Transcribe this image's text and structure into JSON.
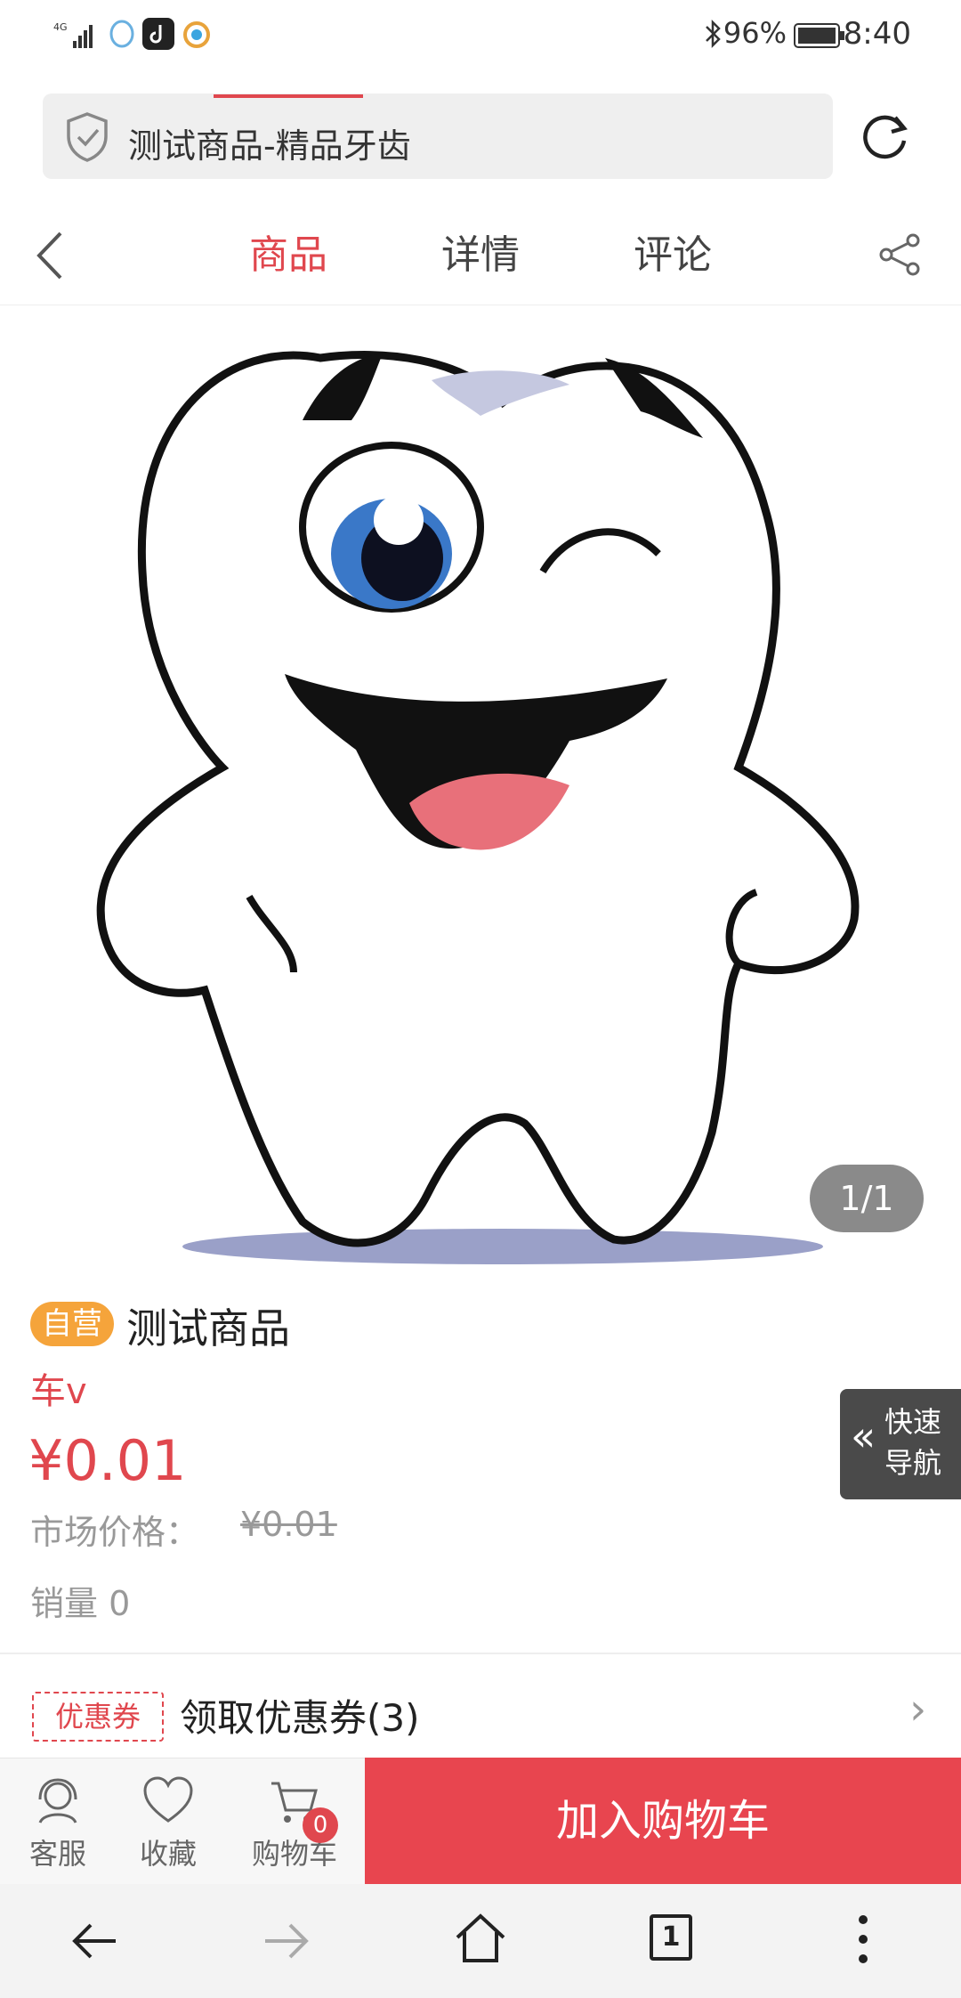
{
  "status_bar": {
    "network": "4G",
    "battery": "96%",
    "time": "8:40"
  },
  "url_bar": {
    "title": "测试商品-精品牙齿"
  },
  "nav_tabs": [
    {
      "label": "商品",
      "active": true
    },
    {
      "label": "详情",
      "active": false
    },
    {
      "label": "评论",
      "active": false
    }
  ],
  "image_counter": "1/1",
  "product": {
    "badge": "自营",
    "name": "测试商品",
    "subtitle": "车v",
    "price": "¥0.01",
    "market_label": "市场价格：",
    "market_price": "¥0.01",
    "sales": "销量 0"
  },
  "quick_nav": {
    "line1": "快速",
    "line2": "导航"
  },
  "coupon": {
    "tag": "优惠券",
    "text": "领取优惠券(3)"
  },
  "action_bar": {
    "service": "客服",
    "favorite": "收藏",
    "cart": "购物车",
    "cart_count": "0",
    "add_to_cart": "加入购物车"
  },
  "system_nav": {
    "tab_count": "1"
  },
  "colors": {
    "accent": "#e0474e",
    "badge": "#f5a43b",
    "add_cart_bg": "#e8454f"
  }
}
